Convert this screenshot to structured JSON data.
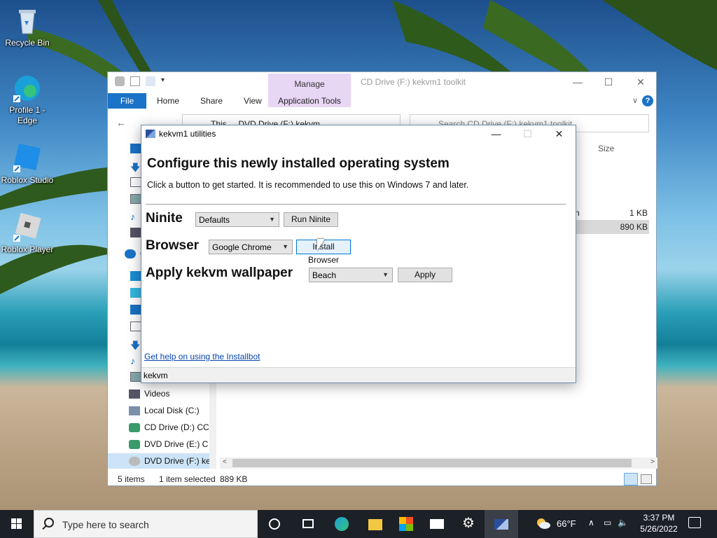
{
  "desktop": {
    "icons": [
      {
        "label": "Recycle Bin"
      },
      {
        "label": "Profile 1 - Edge"
      },
      {
        "label": "Roblox Studio"
      },
      {
        "label": "Roblox Player"
      }
    ]
  },
  "explorer": {
    "manage_tab": "Manage",
    "title": "CD Drive (F:) kekvm1 toolkit",
    "ribbon_tabs": [
      "File",
      "Home",
      "Share",
      "View",
      "Application Tools"
    ],
    "address": "This ... DVD Drive (F:) kekvm",
    "search_placeholder": "Search CD Drive (F:) kekvm1 toolkit",
    "column_size": "Size",
    "files": [
      {
        "name_fragment": "n",
        "size": "1 KB",
        "selected": false
      },
      {
        "name_fragment": "",
        "size": "890 KB",
        "selected": true
      }
    ],
    "nav_items": [
      "Videos",
      "Local Disk (C:)",
      "CD Drive (D:) CC",
      "DVD Drive (E:) C",
      "DVD Drive (F:) ke"
    ],
    "nav_cut_label": "C",
    "status": {
      "items": "5 items",
      "selected": "1 item selected",
      "size": "889 KB"
    }
  },
  "dialog": {
    "title": "kekvm1 utilities",
    "heading": "Configure this newly installed operating system",
    "subtext": "Click a button to get started. It is recommended to use this on Windows 7 and later.",
    "ninite": {
      "label": "Ninite",
      "selected": "Defaults",
      "button": "Run Ninite"
    },
    "browser": {
      "label": "Browser",
      "selected": "Google Chrome",
      "button": "Install Browser"
    },
    "wallpaper": {
      "label": "Apply kekvm wallpaper",
      "selected": "Beach",
      "button": "Apply"
    },
    "help_link": "Get help on using the Installbot",
    "status": "kekvm"
  },
  "taskbar": {
    "search_placeholder": "Type here to search",
    "weather": "66°F",
    "time": "3:37 PM",
    "date": "5/26/2022"
  }
}
